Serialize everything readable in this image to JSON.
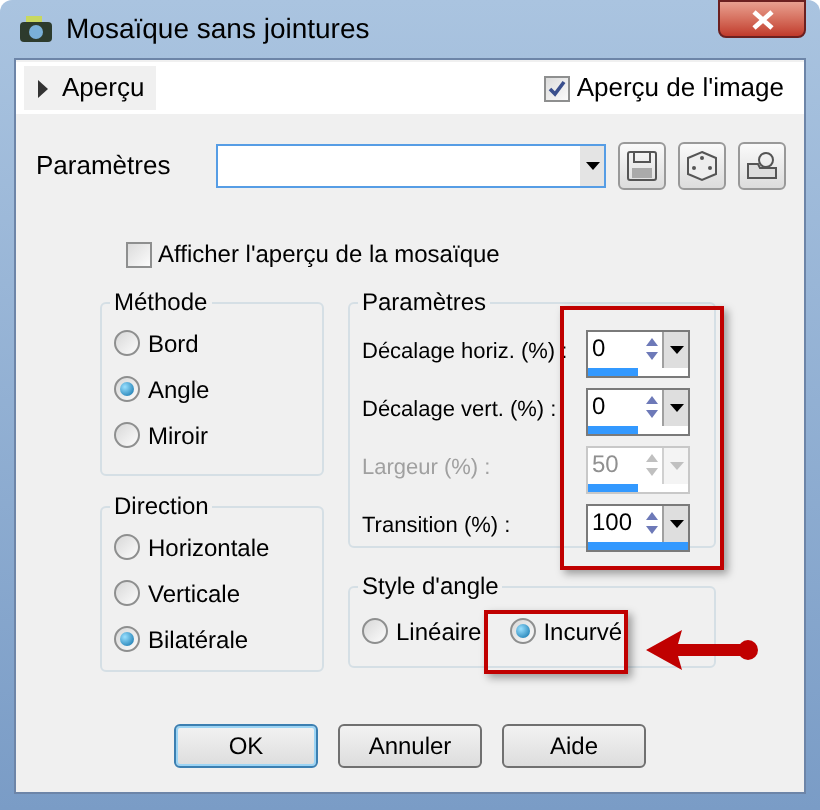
{
  "window": {
    "title": "Mosaïque sans jointures"
  },
  "preview_toggle": {
    "label": "Aperçu",
    "expanded": false
  },
  "image_preview": {
    "label": "Aperçu de l'image",
    "checked": true
  },
  "presets": {
    "label": "Paramètres"
  },
  "tile_preview": {
    "label": "Afficher l'aperçu de la mosaïque",
    "checked": false
  },
  "method": {
    "title": "Méthode",
    "options": [
      {
        "label": "Bord",
        "selected": false
      },
      {
        "label": "Angle",
        "selected": true
      },
      {
        "label": "Miroir",
        "selected": false
      }
    ]
  },
  "direction": {
    "title": "Direction",
    "options": [
      {
        "label": "Horizontale",
        "selected": false
      },
      {
        "label": "Verticale",
        "selected": false
      },
      {
        "label": "Bilatérale",
        "selected": true
      }
    ]
  },
  "parameters": {
    "title": "Paramètres",
    "fields": [
      {
        "label": "Décalage horiz. (%) :",
        "value": "0",
        "level": 0.5,
        "disabled": false
      },
      {
        "label": "Décalage vert. (%) :",
        "value": "0",
        "level": 0.5,
        "disabled": false
      },
      {
        "label": "Largeur (%) :",
        "value": "50",
        "level": 0.5,
        "disabled": true
      },
      {
        "label": "Transition (%) :",
        "value": "100",
        "level": 1,
        "disabled": false
      }
    ]
  },
  "angle_style": {
    "title": "Style d'angle",
    "options": [
      {
        "label": "Linéaire",
        "selected": false
      },
      {
        "label": "Incurvé",
        "selected": true
      }
    ]
  },
  "buttons": [
    {
      "label": "OK",
      "default": true
    },
    {
      "label": "Annuler",
      "default": false
    },
    {
      "label": "Aide",
      "default": false
    }
  ]
}
